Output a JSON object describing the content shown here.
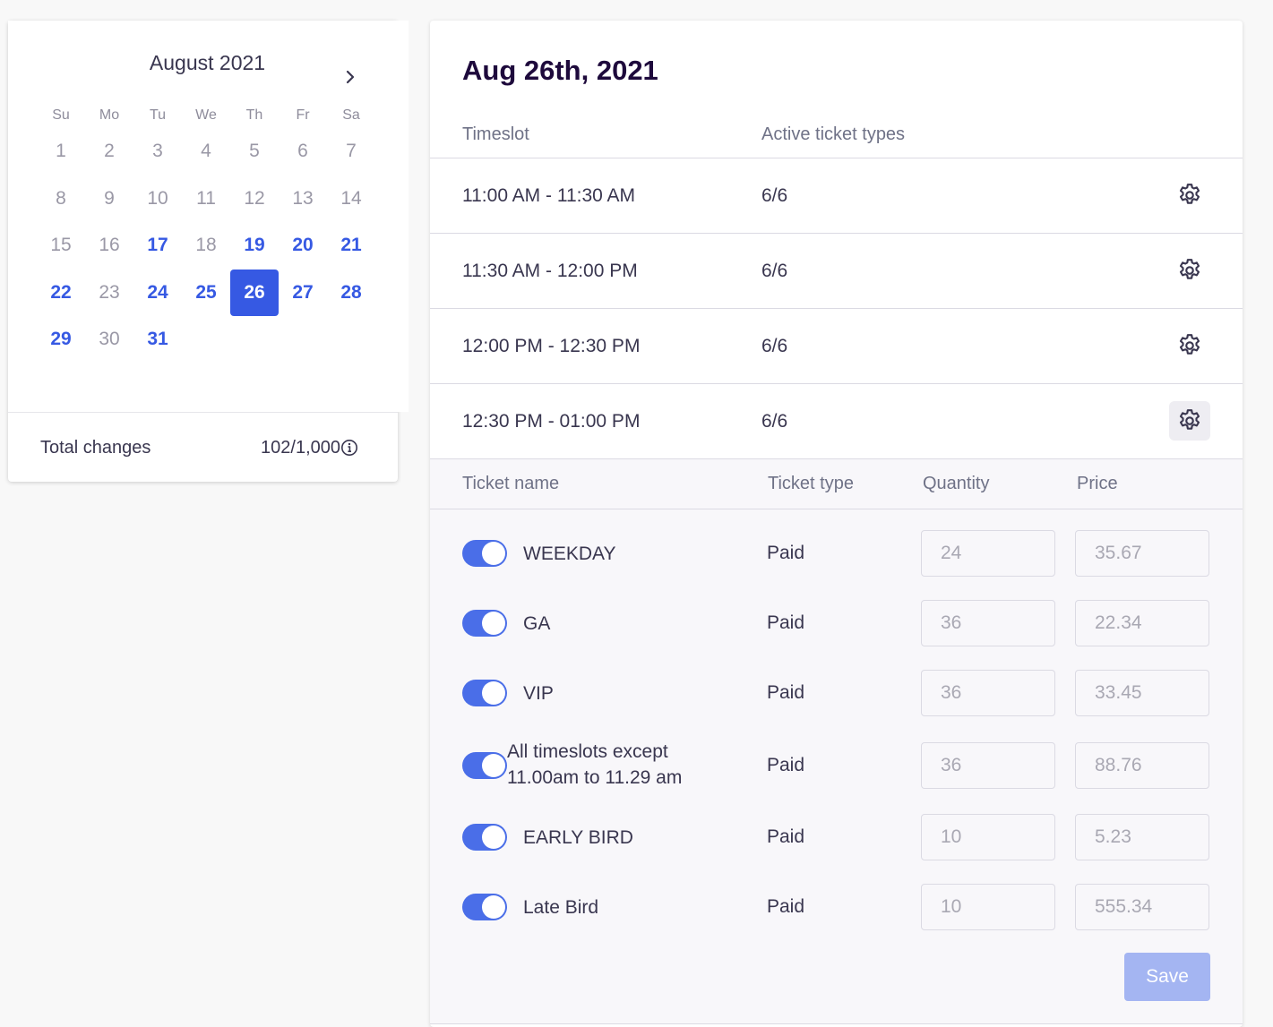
{
  "calendar": {
    "month_title": "August 2021",
    "weekdays": [
      "Su",
      "Mo",
      "Tu",
      "We",
      "Th",
      "Fr",
      "Sa"
    ],
    "days": [
      {
        "label": "1",
        "state": "disabled"
      },
      {
        "label": "2",
        "state": "disabled"
      },
      {
        "label": "3",
        "state": "disabled"
      },
      {
        "label": "4",
        "state": "disabled"
      },
      {
        "label": "5",
        "state": "disabled"
      },
      {
        "label": "6",
        "state": "disabled"
      },
      {
        "label": "7",
        "state": "disabled"
      },
      {
        "label": "8",
        "state": "disabled"
      },
      {
        "label": "9",
        "state": "disabled"
      },
      {
        "label": "10",
        "state": "disabled"
      },
      {
        "label": "11",
        "state": "disabled"
      },
      {
        "label": "12",
        "state": "disabled"
      },
      {
        "label": "13",
        "state": "disabled"
      },
      {
        "label": "14",
        "state": "disabled"
      },
      {
        "label": "15",
        "state": "disabled"
      },
      {
        "label": "16",
        "state": "disabled"
      },
      {
        "label": "17",
        "state": "available"
      },
      {
        "label": "18",
        "state": "disabled"
      },
      {
        "label": "19",
        "state": "available"
      },
      {
        "label": "20",
        "state": "available"
      },
      {
        "label": "21",
        "state": "available"
      },
      {
        "label": "22",
        "state": "available"
      },
      {
        "label": "23",
        "state": "disabled"
      },
      {
        "label": "24",
        "state": "available"
      },
      {
        "label": "25",
        "state": "available"
      },
      {
        "label": "26",
        "state": "selected"
      },
      {
        "label": "27",
        "state": "available"
      },
      {
        "label": "28",
        "state": "available"
      },
      {
        "label": "29",
        "state": "available"
      },
      {
        "label": "30",
        "state": "disabled"
      },
      {
        "label": "31",
        "state": "available"
      }
    ],
    "next_icon": "chevron-right-icon"
  },
  "summary": {
    "total_changes_label": "Total changes",
    "total_changes_value": "102/1,000",
    "info_icon": "info-icon"
  },
  "panel": {
    "date_title": "Aug 26th, 2021",
    "timeslot_header": "Timeslot",
    "active_types_header": "Active ticket types",
    "timeslots": [
      {
        "time": "11:00 AM - 11:30 AM",
        "active": "6/6"
      },
      {
        "time": "11:30 AM - 12:00 PM",
        "active": "6/6"
      },
      {
        "time": "12:00 PM - 12:30 PM",
        "active": "6/6"
      },
      {
        "time": "12:30 PM - 01:00 PM",
        "active": "6/6"
      }
    ],
    "ticket_headers": {
      "name": "Ticket name",
      "type": "Ticket type",
      "quantity": "Quantity",
      "price": "Price"
    },
    "tickets": [
      {
        "name": "WEEKDAY",
        "type": "Paid",
        "quantity": "24",
        "price": "35.67",
        "enabled": true
      },
      {
        "name": "GA",
        "type": "Paid",
        "quantity": "36",
        "price": "22.34",
        "enabled": true
      },
      {
        "name": "VIP",
        "type": "Paid",
        "quantity": "36",
        "price": "33.45",
        "enabled": true
      },
      {
        "name": "All timeslots except 11.00am to 11.29 am",
        "type": "Paid",
        "quantity": "36",
        "price": "88.76",
        "enabled": true
      },
      {
        "name": "EARLY BIRD",
        "type": "Paid",
        "quantity": "10",
        "price": "5.23",
        "enabled": true
      },
      {
        "name": "Late Bird",
        "type": "Paid",
        "quantity": "10",
        "price": "555.34",
        "enabled": true
      }
    ],
    "save_label": "Save"
  },
  "colors": {
    "accent": "#3659e3",
    "toggle_on": "#4a6ee8",
    "save_disabled": "#a4b5f2"
  }
}
